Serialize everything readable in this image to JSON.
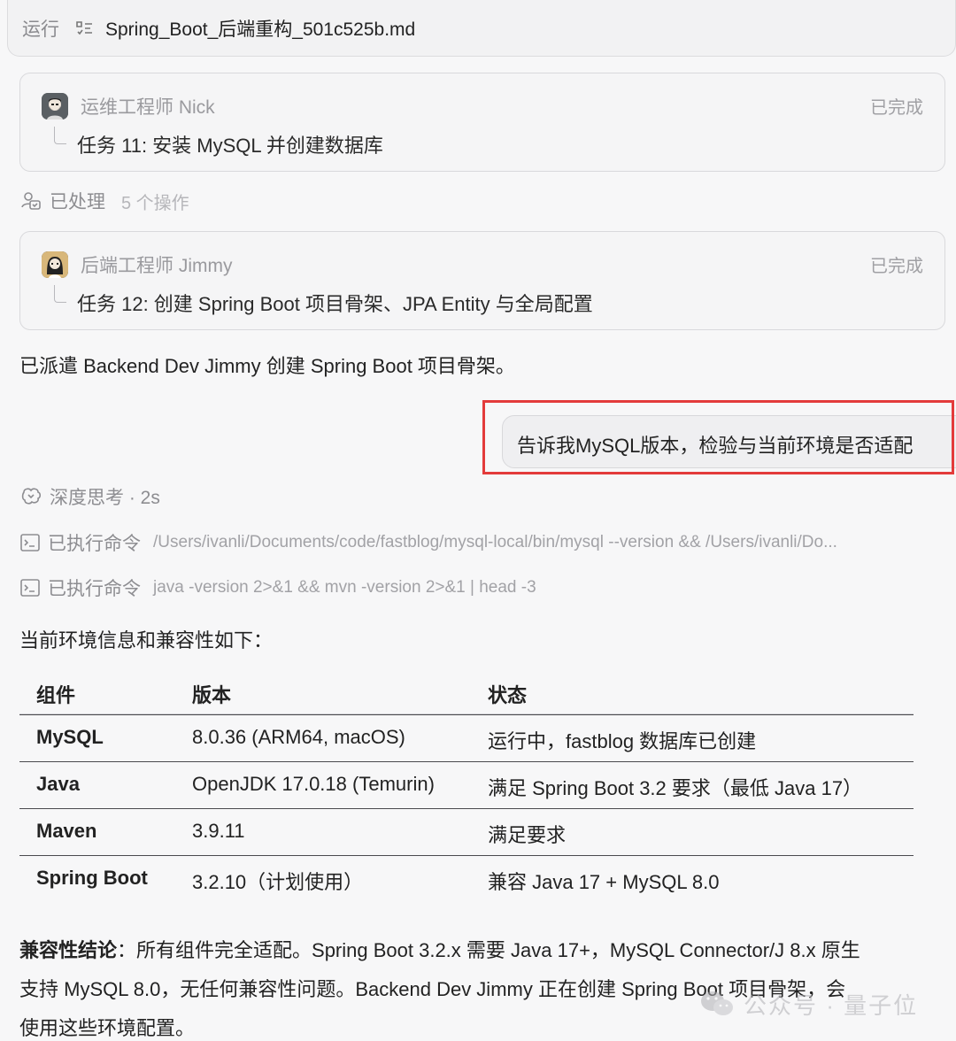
{
  "top_bar": {
    "run_label": "运行",
    "file_name": "Spring_Boot_后端重构_501c525b.md"
  },
  "task_cards": [
    {
      "assignee": "运维工程师 Nick",
      "status": "已完成",
      "title": "任务 11: 安装 MySQL 并创建数据库"
    },
    {
      "assignee": "后端工程师 Jimmy",
      "status": "已完成",
      "title": "任务 12: 创建 Spring Boot 项目骨架、JPA Entity 与全局配置"
    }
  ],
  "processed": {
    "label": "已处理",
    "count": "5 个操作"
  },
  "dispatch_message": "已派遣 Backend Dev Jimmy 创建 Spring Boot 项目骨架。",
  "user_message": "告诉我MySQL版本，检验与当前环境是否适配",
  "thinking": {
    "label": "深度思考 · 2s"
  },
  "commands": [
    {
      "label": "已执行命令",
      "command": "/Users/ivanli/Documents/code/fastblog/mysql-local/bin/mysql --version && /Users/ivanli/Do..."
    },
    {
      "label": "已执行命令",
      "command": "java -version 2>&1 && mvn -version 2>&1 | head -3"
    }
  ],
  "env_intro": "当前环境信息和兼容性如下：",
  "env_table": {
    "headers": [
      "组件",
      "版本",
      "状态"
    ],
    "rows": [
      [
        "MySQL",
        "8.0.36 (ARM64, macOS)",
        "运行中，fastblog 数据库已创建"
      ],
      [
        "Java",
        "OpenJDK 17.0.18 (Temurin)",
        "满足 Spring Boot 3.2 要求（最低 Java 17）"
      ],
      [
        "Maven",
        "3.9.11",
        "满足要求"
      ],
      [
        "Spring Boot",
        "3.2.10（计划使用）",
        "兼容 Java 17 + MySQL 8.0"
      ]
    ]
  },
  "conclusion": {
    "label": "兼容性结论",
    "line1": "：所有组件完全适配。Spring Boot 3.2.x 需要 Java 17+，MySQL Connector/J 8.x 原生",
    "line2": "支持 MySQL 8.0，无任何兼容性问题。Backend Dev Jimmy 正在创建 Spring Boot 项目骨架，会",
    "line3": "使用这些环境配置。"
  },
  "watermark": {
    "text": "公众号 · 量子位"
  },
  "colors": {
    "highlight": "#e33b3b",
    "muted": "#8d8d91",
    "background": "#f7f7f8"
  },
  "icons": {
    "run_doc": "document-list-icon",
    "avatar_nick": "avatar-bearded-icon",
    "avatar_jimmy": "avatar-longhair-icon",
    "processed": "people-check-icon",
    "thinking": "brain-loop-icon",
    "terminal": "terminal-icon",
    "watermark": "wechat-icon"
  }
}
